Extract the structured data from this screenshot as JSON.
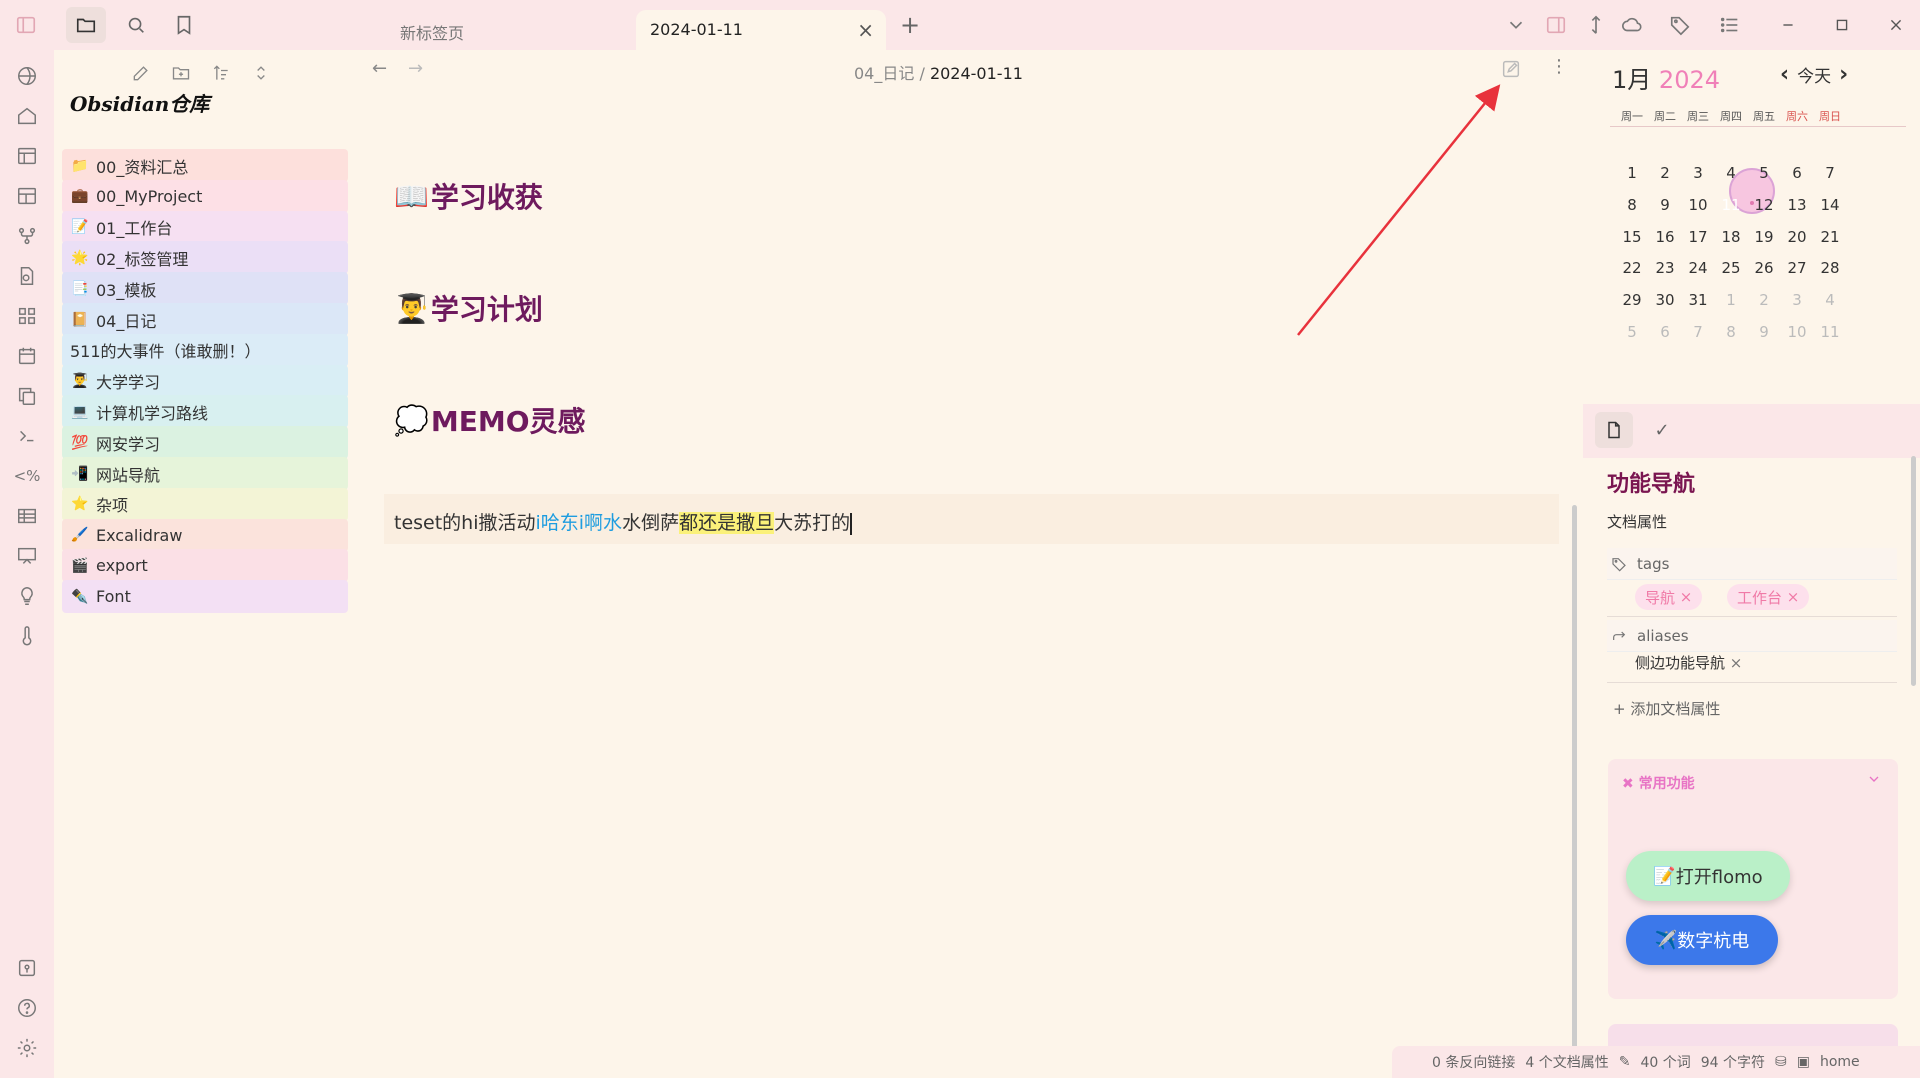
{
  "titlebar": {
    "tabs": [
      {
        "label": "新标签页",
        "active": false
      },
      {
        "label": "2024-01-11",
        "active": true
      }
    ],
    "new_tab_symbol": "+",
    "close_symbol": "×"
  },
  "explorer": {
    "vault_name": "Obsidian仓库",
    "folders": [
      {
        "label": "00_资料汇总",
        "icon": "📁",
        "color": "#fde0dc"
      },
      {
        "label": "00_MyProject",
        "icon": "💼",
        "color": "#fde0e6"
      },
      {
        "label": "01_工作台",
        "icon": "📝",
        "color": "#f6e0f2"
      },
      {
        "label": "02_标签管理",
        "icon": "🌟",
        "color": "#ebdff6"
      },
      {
        "label": "03_模板",
        "icon": "📑",
        "color": "#dfe1f6"
      },
      {
        "label": "04_日记",
        "icon": "📔",
        "color": "#dbe7f7"
      },
      {
        "label": "511的大事件（谁敢删！）",
        "icon": "",
        "color": "#dbecf7"
      },
      {
        "label": "大学学习",
        "icon": "👨‍🎓",
        "color": "#d9eef5"
      },
      {
        "label": "计算机学习路线",
        "icon": "💻",
        "color": "#d8f0f0"
      },
      {
        "label": "网安学习",
        "icon": "💯",
        "color": "#dbf2e1"
      },
      {
        "label": "网站导航",
        "icon": "📲",
        "color": "#e6f4da"
      },
      {
        "label": "杂项",
        "icon": "⭐",
        "color": "#f3f4d6"
      },
      {
        "label": "Excalidraw",
        "icon": "🖌️",
        "color": "#fbe3dc"
      },
      {
        "label": "export",
        "icon": "🎬",
        "color": "#fbe0e6"
      },
      {
        "label": "Font",
        "icon": "✒️",
        "color": "#f3e0f4"
      }
    ]
  },
  "editor": {
    "breadcrumb_folder": "04_日记",
    "breadcrumb_sep": " / ",
    "breadcrumb_file": "2024-01-11",
    "headings": [
      {
        "icon": "📖",
        "text": "学习收获"
      },
      {
        "icon": "👨‍🎓",
        "text": "学习计划"
      },
      {
        "icon": "💭",
        "text": "MEMO灵感"
      }
    ],
    "line_parts": [
      {
        "text": "teset的hi撒活动",
        "style": "plain"
      },
      {
        "text": "i哈东i啊水",
        "style": "blue"
      },
      {
        "text": "水倒萨",
        "style": "plain"
      },
      {
        "text": "都还是撒旦",
        "style": "mark"
      },
      {
        "text": "大苏打的",
        "style": "plain"
      }
    ]
  },
  "calendar": {
    "month": "1月",
    "year": "2024",
    "today_label": "今天",
    "weekdays": [
      "周一",
      "周二",
      "周三",
      "周四",
      "周五",
      "周六",
      "周日"
    ],
    "weeks": [
      [
        "1",
        "2",
        "3",
        "4",
        "5",
        "6",
        "7"
      ],
      [
        "8",
        "9",
        "10",
        "11",
        "12",
        "13",
        "14"
      ],
      [
        "15",
        "16",
        "17",
        "18",
        "19",
        "20",
        "21"
      ],
      [
        "22",
        "23",
        "24",
        "25",
        "26",
        "27",
        "28"
      ],
      [
        "29",
        "30",
        "31",
        "1",
        "2",
        "3",
        "4"
      ],
      [
        "5",
        "6",
        "7",
        "8",
        "9",
        "10",
        "11"
      ]
    ],
    "selected_day": "11",
    "weekend_color": "#d9534f",
    "accent": "#f080b8"
  },
  "properties": {
    "note_title": "功能导航",
    "section_label": "文档属性",
    "tags_key": "tags",
    "tags": [
      "导航",
      "工作台"
    ],
    "aliases_key": "aliases",
    "aliases": [
      "侧边功能导航"
    ],
    "remove_symbol": "×",
    "add_label": "添加文档属性"
  },
  "functions": {
    "title": "常用功能",
    "buttons": [
      {
        "icon": "📝",
        "label": "打开flomo"
      },
      {
        "icon": "✈️",
        "label": "数字杭电"
      }
    ]
  },
  "statusbar": {
    "backlinks": "0 条反向链接",
    "props": "4 个文档属性",
    "words": "40 个词",
    "chars": "94 个字符",
    "home": "home"
  }
}
